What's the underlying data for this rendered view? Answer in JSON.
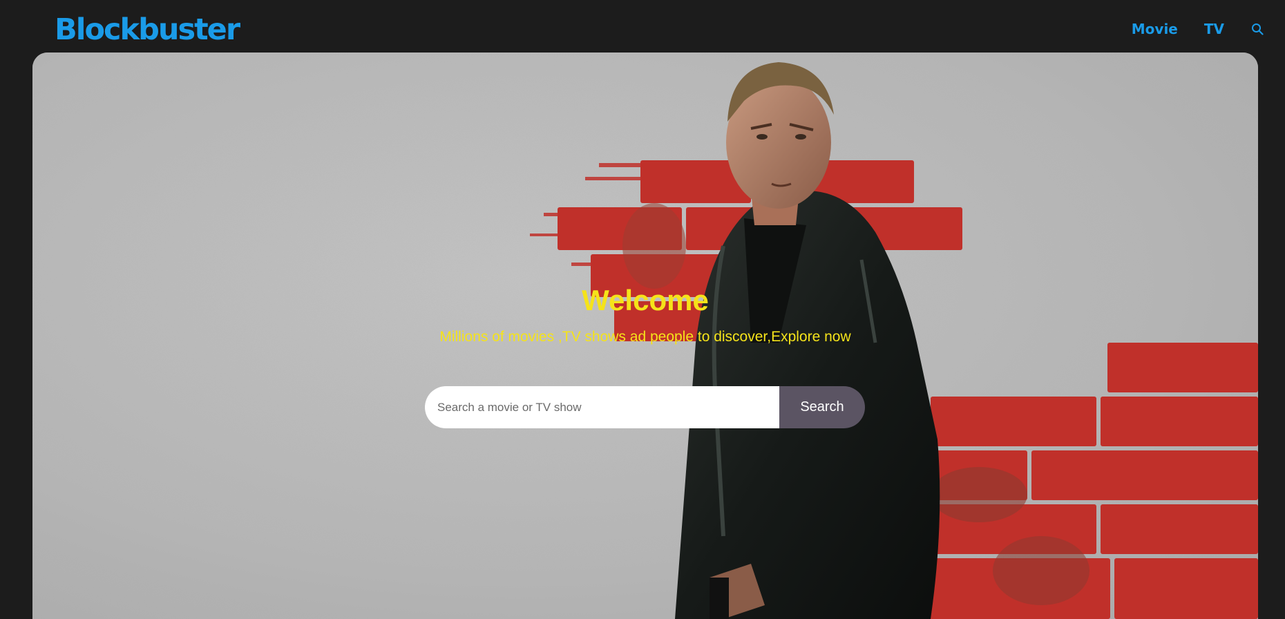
{
  "header": {
    "logo_text": "Blockbuster",
    "nav": [
      {
        "label": "Movie"
      },
      {
        "label": "TV"
      }
    ],
    "search_icon": "search-icon"
  },
  "hero": {
    "title": "Welcome",
    "subtitle": "Millions of movies ,TV shows ad people to discover,Explore now",
    "search": {
      "placeholder": "Search a movie or TV show",
      "value": "",
      "button_label": "Search"
    },
    "background_image": "movie-poster-man-in-leather-jacket-red-brick-wall"
  },
  "colors": {
    "background": "#1c1c1c",
    "accent": "#1a9be8",
    "hero_text": "#f5e31a",
    "search_button": "#5b5463",
    "brick_red": "#c0302a"
  }
}
